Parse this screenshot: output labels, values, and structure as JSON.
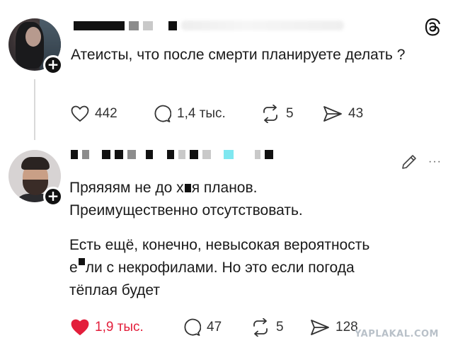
{
  "posts": [
    {
      "text": [
        "Атеисты, что после смерти планируете делать ?"
      ],
      "actions": {
        "likes": "442",
        "replies": "1,4 тыс.",
        "reposts": "5",
        "shares": "43"
      },
      "liked": false
    },
    {
      "text_line1_part1": "Пряяяям не до х",
      "text_line1_part2": "я планов.",
      "text_line2": "Преимущественно отсутствовать.",
      "text_para2_line1": "Есть ещё, конечно, невысокая вероятность",
      "text_para2_line2_part1": "е",
      "text_para2_line2_part2": "ли с некрофилами. Но это если погода",
      "text_para2_line3": "тёплая будет",
      "actions": {
        "likes": "1,9 тыс.",
        "replies": "47",
        "reposts": "5",
        "shares": "128"
      },
      "liked": true
    }
  ],
  "icons": {
    "app_logo": "threads-logo-icon",
    "edit": "pencil-icon",
    "more": "more-dots-icon",
    "follow": "plus-icon",
    "like": "heart-icon",
    "reply": "comment-icon",
    "repost": "repost-icon",
    "share": "send-icon"
  },
  "more_label": "···",
  "follow_label": "+",
  "colors": {
    "like_active": "#e31e3b",
    "text": "#1a1a1a",
    "icon": "#333333"
  },
  "watermark": "YAPLAKAL.COM"
}
